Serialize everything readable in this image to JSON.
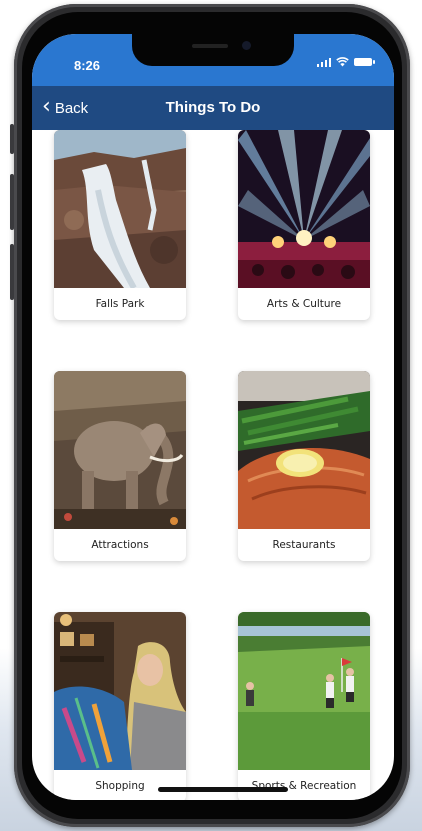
{
  "status_bar": {
    "time": "8:26"
  },
  "nav": {
    "back_label": "Back",
    "title": "Things To Do"
  },
  "categories": [
    {
      "label": "Falls Park",
      "image": "waterfall-photo"
    },
    {
      "label": "Arts & Culture",
      "image": "concert-stage-photo"
    },
    {
      "label": "Attractions",
      "image": "elephant-exhibit-photo"
    },
    {
      "label": "Restaurants",
      "image": "salmon-dish-photo"
    },
    {
      "label": "Shopping",
      "image": "boutique-shopping-photo"
    },
    {
      "label": "Sports & Recreation",
      "image": "golf-course-photo"
    }
  ],
  "colors": {
    "status_bar": "#2a77d0",
    "nav_bar": "#1f4a82"
  }
}
